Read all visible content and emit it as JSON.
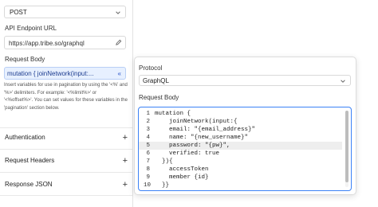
{
  "left": {
    "method": "POST",
    "endpoint_label": "API Endpoint URL",
    "endpoint_value": "https://app.tribe.so/graphql",
    "body_label": "Request Body",
    "body_value": "mutation { joinNetwork(input:...",
    "insert_icon": "«",
    "help_lines": [
      "Insert variables for use in pagination by using the '<%' and",
      "'%>' delimiters. For example: '<%limit%>' or",
      "'<%offset%>'. You can set values for these variables in the",
      "'pagination' section below."
    ],
    "sections": [
      {
        "label": "Authentication",
        "icon": "+"
      },
      {
        "label": "Request Headers",
        "icon": "+"
      },
      {
        "label": "Response JSON",
        "icon": "+"
      }
    ]
  },
  "popup": {
    "protocol_label": "Protocol",
    "protocol_value": "GraphQL",
    "body_label": "Request Body",
    "code_lines": [
      {
        "n": "1",
        "text": "mutation {"
      },
      {
        "n": "2",
        "text": "    joinNetwork(input:{"
      },
      {
        "n": "3",
        "text": "    email: \"{email_address}\""
      },
      {
        "n": "4",
        "text": "    name: \"{new_username}\""
      },
      {
        "n": "5",
        "text": "    password: \"{pw}\","
      },
      {
        "n": "6",
        "text": "    verified: true"
      },
      {
        "n": "7",
        "text": "  }){"
      },
      {
        "n": "8",
        "text": "    accessToken"
      },
      {
        "n": "9",
        "text": "    member {id}"
      },
      {
        "n": "10",
        "text": "  }}"
      }
    ],
    "highlighted_line": 5
  },
  "colors": {
    "accent": "#3b82f6",
    "highlight_field": "#e7f0ff"
  }
}
